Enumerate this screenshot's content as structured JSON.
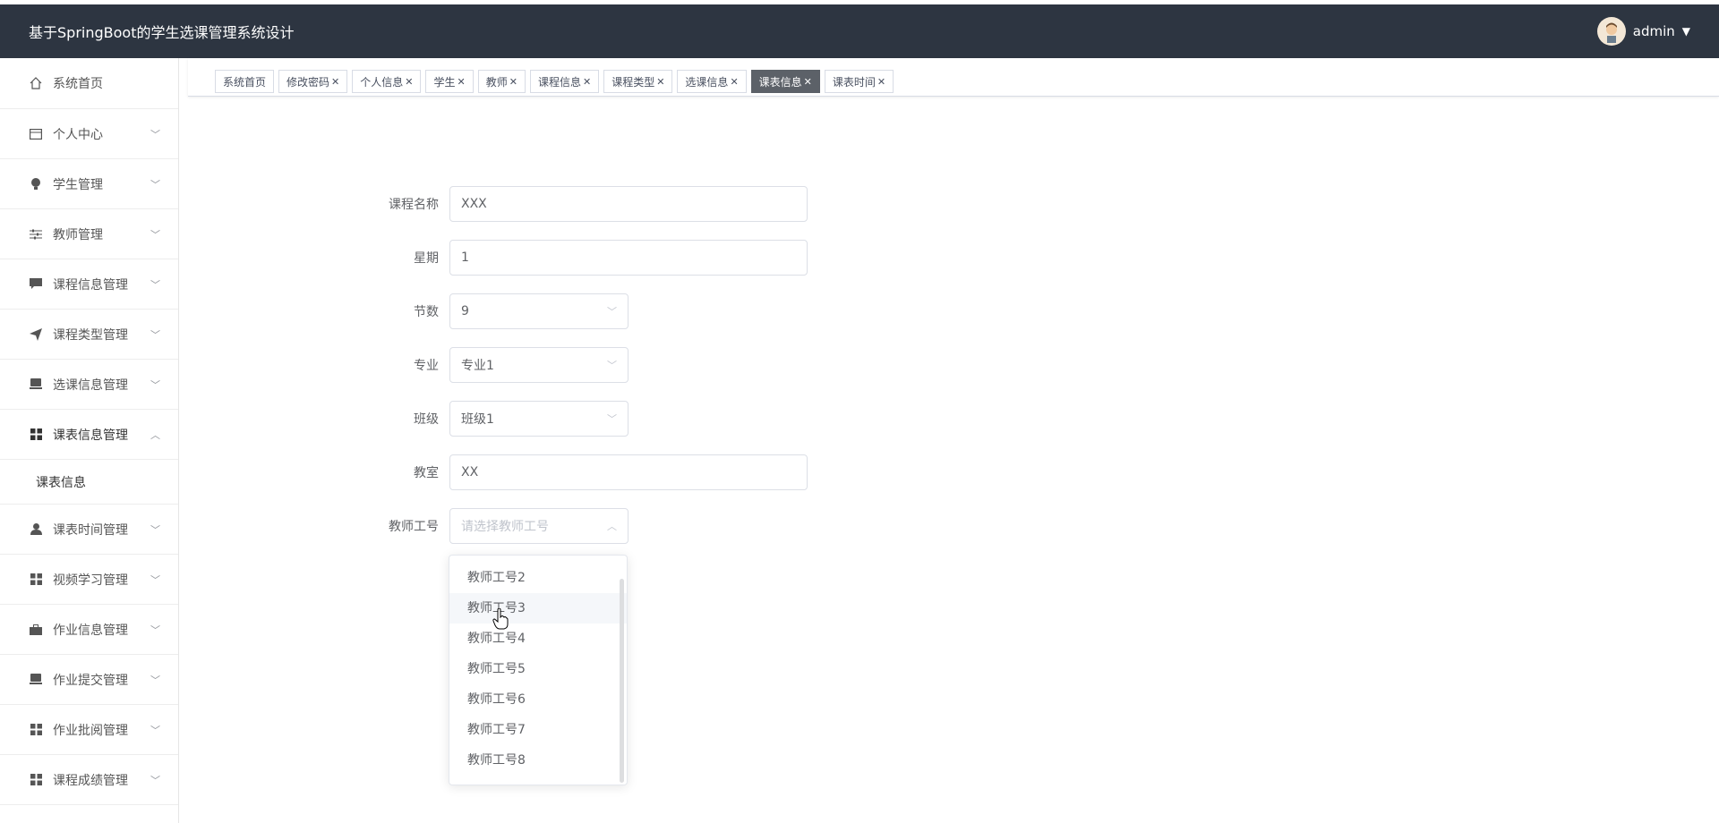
{
  "header": {
    "title": "基于SpringBoot的学生选课管理系统设计",
    "username": "admin"
  },
  "sidebar": {
    "items": [
      {
        "label": "系统首页",
        "icon": "home-icon"
      },
      {
        "label": "个人中心",
        "icon": "card-icon"
      },
      {
        "label": "学生管理",
        "icon": "bulb-icon"
      },
      {
        "label": "教师管理",
        "icon": "sliders-icon"
      },
      {
        "label": "课程信息管理",
        "icon": "chat-icon"
      },
      {
        "label": "课程类型管理",
        "icon": "send-icon"
      },
      {
        "label": "选课信息管理",
        "icon": "monitor-icon"
      },
      {
        "label": "课表信息管理",
        "icon": "grid-icon"
      },
      {
        "label": "课表时间管理",
        "icon": "user-icon"
      },
      {
        "label": "视频学习管理",
        "icon": "grid-icon"
      },
      {
        "label": "作业信息管理",
        "icon": "briefcase-icon"
      },
      {
        "label": "作业提交管理",
        "icon": "monitor-icon"
      },
      {
        "label": "作业批阅管理",
        "icon": "grid-icon"
      },
      {
        "label": "课程成绩管理",
        "icon": "grid-icon"
      }
    ],
    "sub_item": "课表信息"
  },
  "tabs": [
    {
      "label": "系统首页"
    },
    {
      "label": "修改密码"
    },
    {
      "label": "个人信息"
    },
    {
      "label": "学生"
    },
    {
      "label": "教师"
    },
    {
      "label": "课程信息"
    },
    {
      "label": "课程类型"
    },
    {
      "label": "选课信息"
    },
    {
      "label": "课表信息"
    },
    {
      "label": "课表时间"
    }
  ],
  "form": {
    "course_name": {
      "label": "课程名称",
      "value": "XXX"
    },
    "weekday": {
      "label": "星期",
      "value": "1"
    },
    "section": {
      "label": "节数",
      "value": "9"
    },
    "major": {
      "label": "专业",
      "value": "专业1"
    },
    "class": {
      "label": "班级",
      "value": "班级1"
    },
    "classroom": {
      "label": "教室",
      "value": "XX"
    },
    "teacher_id": {
      "label": "教师工号",
      "placeholder": "请选择教师工号"
    }
  },
  "dropdown": {
    "options": [
      "教师工号2",
      "教师工号3",
      "教师工号4",
      "教师工号5",
      "教师工号6",
      "教师工号7",
      "教师工号8"
    ],
    "hovered": "教师工号3"
  },
  "colors": {
    "header_bg": "#2d3541",
    "active_tab_bg": "#5c6168"
  }
}
